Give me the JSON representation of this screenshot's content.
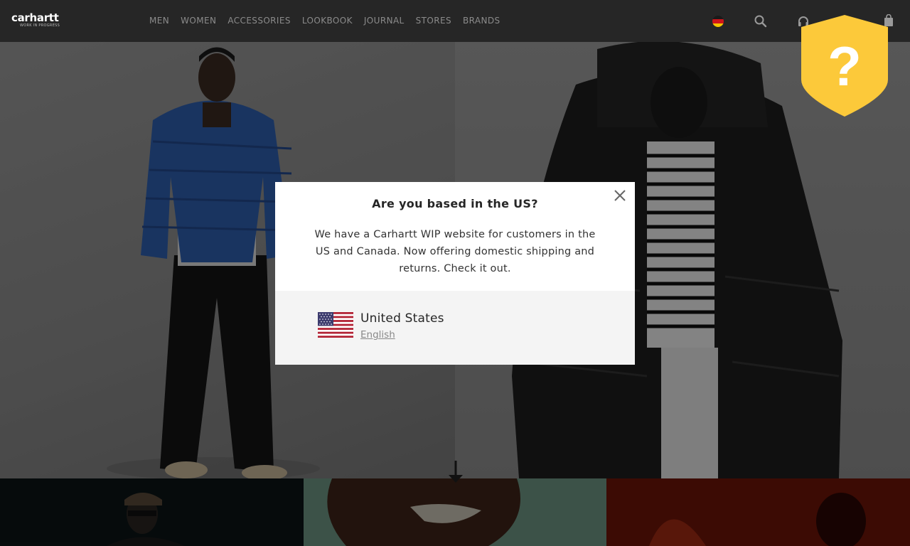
{
  "header": {
    "logo": {
      "wordmark": "carhartt",
      "subline": "WORK IN PROGRESS"
    },
    "nav": [
      {
        "label": "MEN"
      },
      {
        "label": "WOMEN"
      },
      {
        "label": "ACCESSORIES"
      },
      {
        "label": "LOOKBOOK"
      },
      {
        "label": "JOURNAL"
      },
      {
        "label": "STORES"
      },
      {
        "label": "BRANDS"
      }
    ],
    "icons": [
      "germany-flag-icon",
      "search-icon",
      "headphones-icon",
      "shopping-bag-icon"
    ]
  },
  "modal": {
    "title": "Are you based in the US?",
    "body": "We have a Carhartt WIP website for customers in the US and Canada. Now offering domestic shipping and returns. Check it out.",
    "option": {
      "country": "United States",
      "language": "English",
      "flag_icon": "us-flag-icon"
    }
  },
  "help_badge": {
    "symbol": "?",
    "color": "#fcc93a"
  },
  "colors": {
    "header_bg": "#262626",
    "nav_text": "#8b8b8b",
    "modal_bg": "#ffffff",
    "modal_footer_bg": "#f4f4f4"
  }
}
